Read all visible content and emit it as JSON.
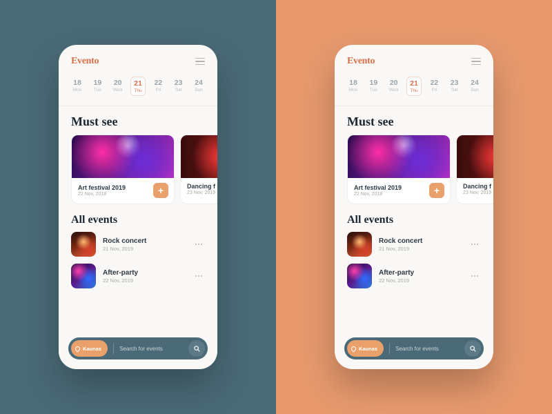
{
  "brand": "Evento",
  "calendar": {
    "days": [
      {
        "num": "18",
        "label": "Mon"
      },
      {
        "num": "19",
        "label": "Tue"
      },
      {
        "num": "20",
        "label": "Wed"
      },
      {
        "num": "21",
        "label": "Thu",
        "selected": true
      },
      {
        "num": "22",
        "label": "Fri"
      },
      {
        "num": "23",
        "label": "Sat"
      },
      {
        "num": "24",
        "label": "Sun"
      }
    ]
  },
  "sections": {
    "must_see": "Must see",
    "all_events": "All events"
  },
  "must_see": [
    {
      "title": "Art festival 2019",
      "date": "22 Nov, 2019"
    },
    {
      "title": "Dancing f",
      "date": "23 Nov, 2019"
    }
  ],
  "events": [
    {
      "title": "Rock concert",
      "date": "21 Nov, 2019"
    },
    {
      "title": "After-party",
      "date": "22 Nov, 2019"
    }
  ],
  "search": {
    "chip": "Kaunas",
    "placeholder": "Search for events"
  },
  "colors": {
    "bg_left": "#4a6a77",
    "bg_right": "#e89a6e",
    "accent": "#d96f4a",
    "chip": "#e9a06a"
  }
}
